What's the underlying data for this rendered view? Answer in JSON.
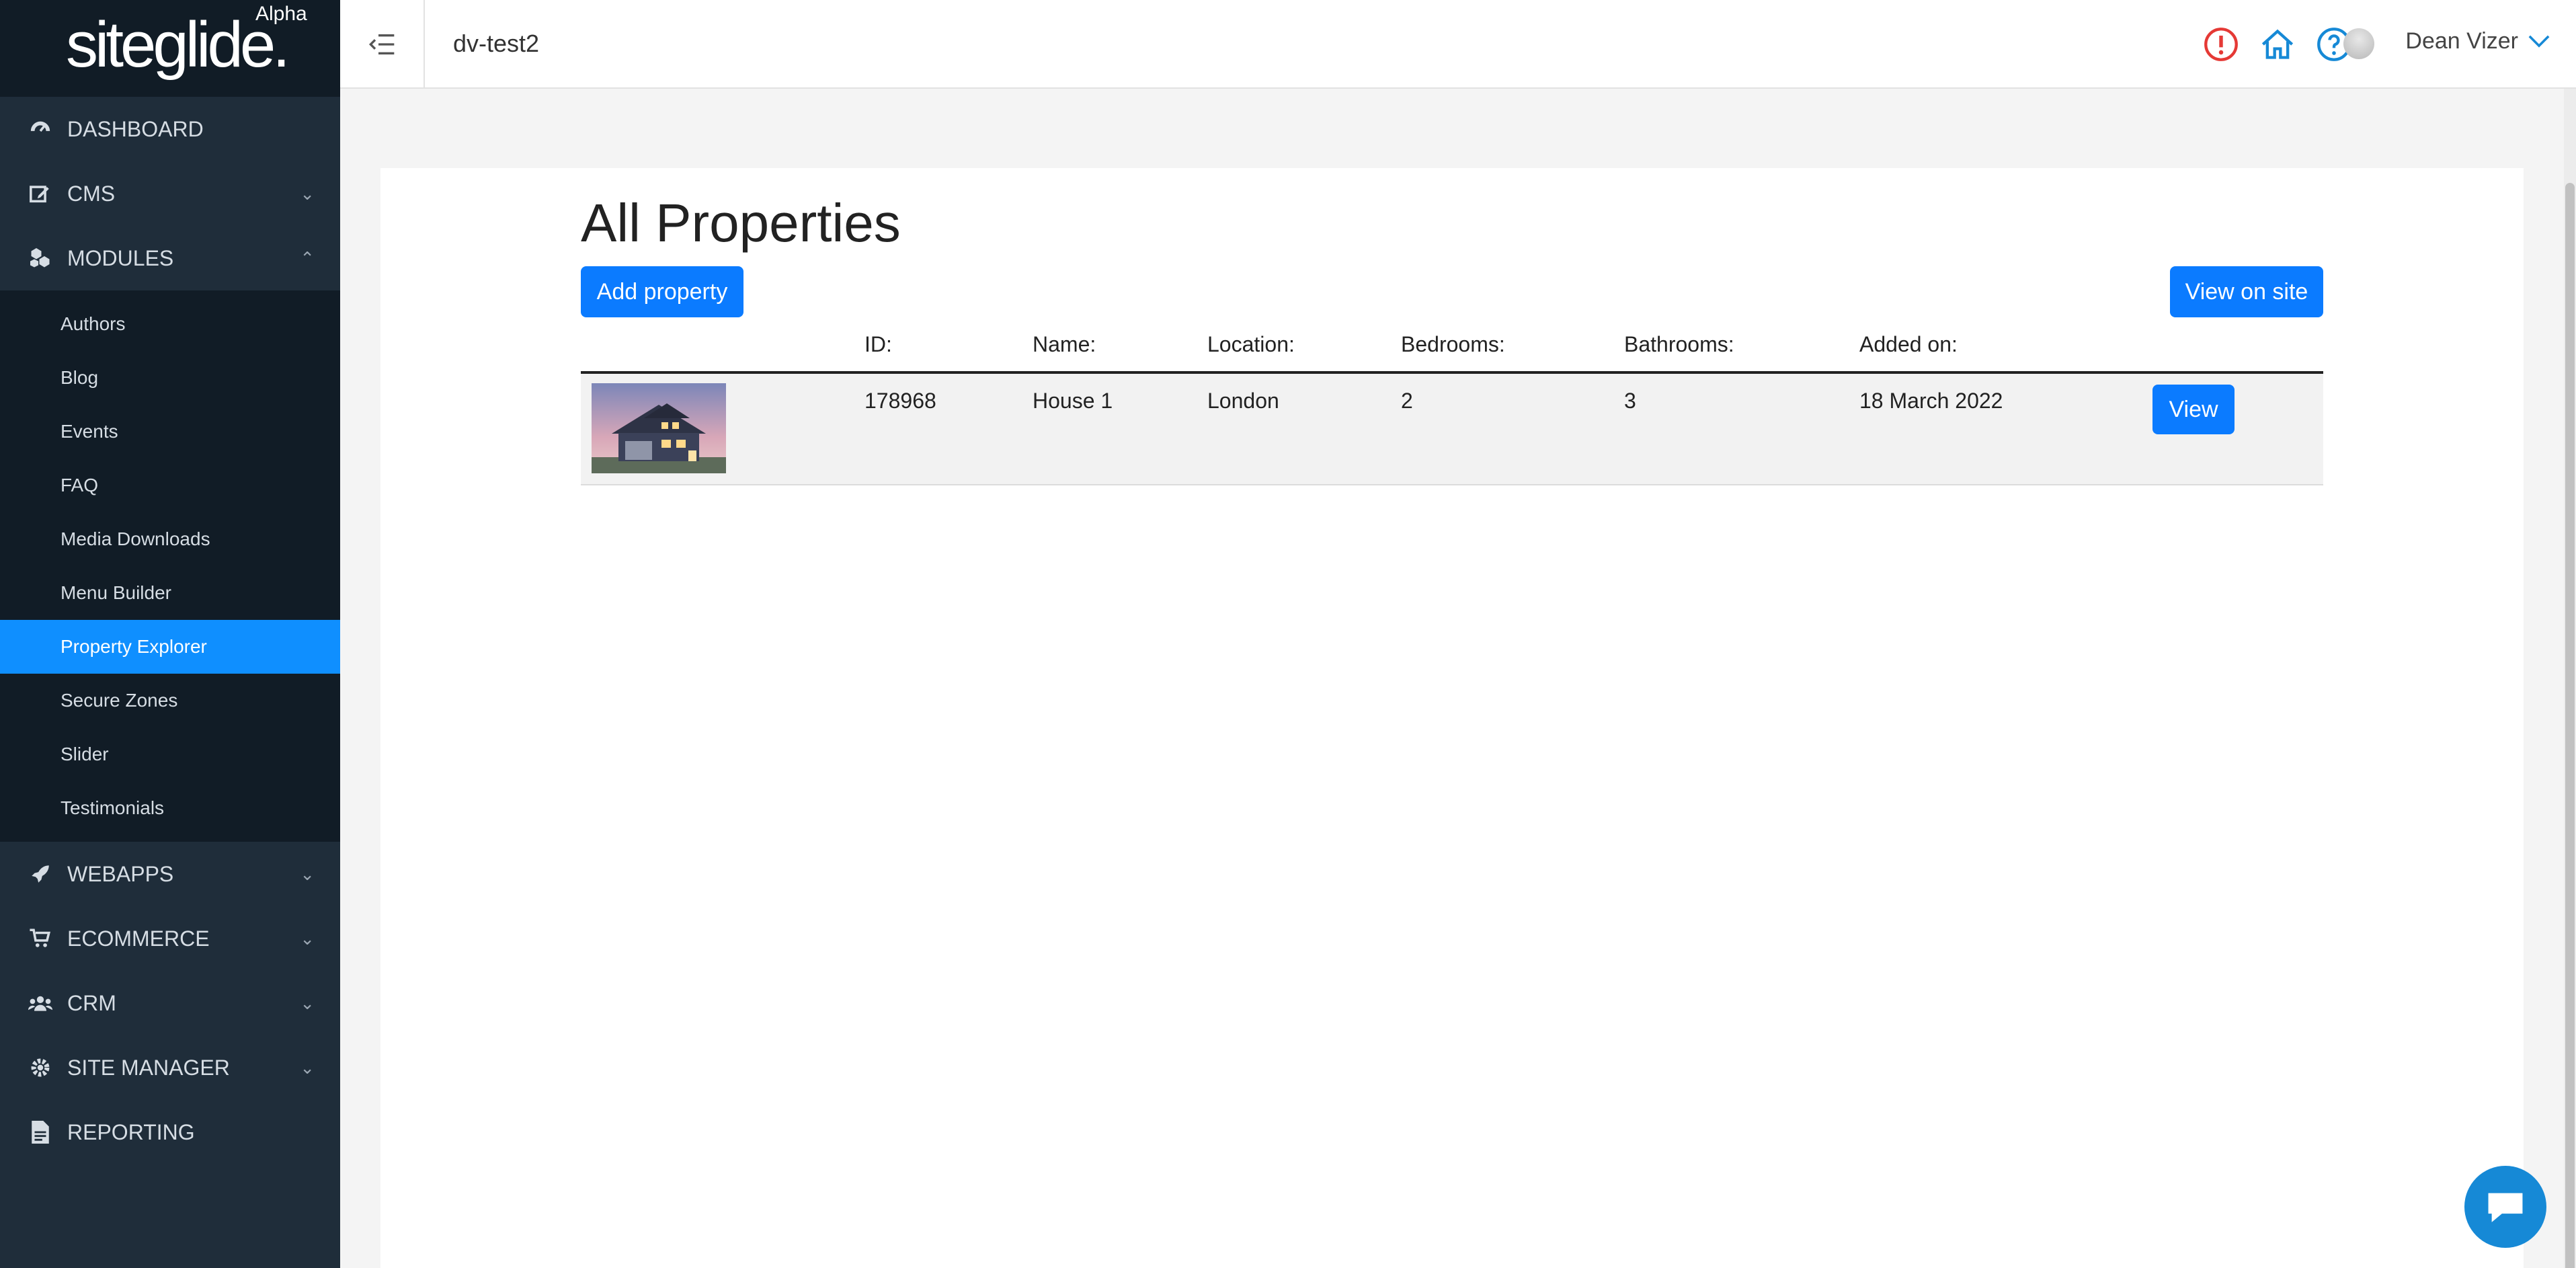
{
  "brand": {
    "logo_text": "siteglide.",
    "badge": "Alpha"
  },
  "sidebar": {
    "items": [
      {
        "label": "DASHBOARD",
        "icon": "dashboard-icon"
      },
      {
        "label": "CMS",
        "icon": "edit-icon"
      },
      {
        "label": "MODULES",
        "icon": "modules-icon"
      },
      {
        "label": "WEBAPPS",
        "icon": "rocket-icon"
      },
      {
        "label": "ECOMMERCE",
        "icon": "cart-icon"
      },
      {
        "label": "CRM",
        "icon": "users-icon"
      },
      {
        "label": "SITE MANAGER",
        "icon": "gear-icon"
      },
      {
        "label": "REPORTING",
        "icon": "file-icon"
      }
    ],
    "modules_sub": [
      "Authors",
      "Blog",
      "Events",
      "FAQ",
      "Media Downloads",
      "Menu Builder",
      "Property Explorer",
      "Secure Zones",
      "Slider",
      "Testimonials"
    ]
  },
  "header": {
    "site_name": "dv-test2",
    "user_name": "Dean Vizer"
  },
  "main": {
    "title": "All Properties",
    "add_button": "Add property",
    "view_site_button": "View on site",
    "columns": [
      "ID:",
      "Name:",
      "Location:",
      "Bedrooms:",
      "Bathrooms:",
      "Added on:"
    ],
    "rows": [
      {
        "id": "178968",
        "name": "House 1",
        "location": "London",
        "bedrooms": "2",
        "bathrooms": "3",
        "added_on": "18 March 2022",
        "view_label": "View"
      }
    ]
  },
  "colors": {
    "accent": "#0b7bff",
    "sidebar_bg": "#1f2d3a",
    "active": "#0f8fff",
    "alert": "#e53935",
    "link": "#1689d6"
  }
}
